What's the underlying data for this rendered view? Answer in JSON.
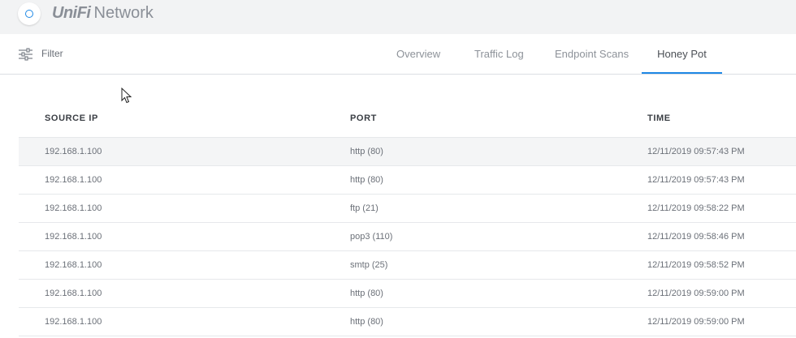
{
  "app": {
    "brand_primary": "UniFi",
    "brand_secondary": "Network",
    "accent_color": "#1e88e5"
  },
  "filter": {
    "label": "Filter",
    "icon": "sliders-icon"
  },
  "tabs": [
    {
      "label": "Overview",
      "active": false
    },
    {
      "label": "Traffic Log",
      "active": false
    },
    {
      "label": "Endpoint Scans",
      "active": false
    },
    {
      "label": "Honey Pot",
      "active": true
    }
  ],
  "table": {
    "headers": {
      "source_ip": "SOURCE IP",
      "port": "PORT",
      "time": "TIME"
    },
    "rows": [
      {
        "source_ip": "192.168.1.100",
        "port": "http (80)",
        "time": "12/11/2019 09:57:43 PM"
      },
      {
        "source_ip": "192.168.1.100",
        "port": "http (80)",
        "time": "12/11/2019 09:57:43 PM"
      },
      {
        "source_ip": "192.168.1.100",
        "port": "ftp (21)",
        "time": "12/11/2019 09:58:22 PM"
      },
      {
        "source_ip": "192.168.1.100",
        "port": "pop3 (110)",
        "time": "12/11/2019 09:58:46 PM"
      },
      {
        "source_ip": "192.168.1.100",
        "port": "smtp (25)",
        "time": "12/11/2019 09:58:52 PM"
      },
      {
        "source_ip": "192.168.1.100",
        "port": "http (80)",
        "time": "12/11/2019 09:59:00 PM"
      },
      {
        "source_ip": "192.168.1.100",
        "port": "http (80)",
        "time": "12/11/2019 09:59:00 PM"
      }
    ]
  }
}
